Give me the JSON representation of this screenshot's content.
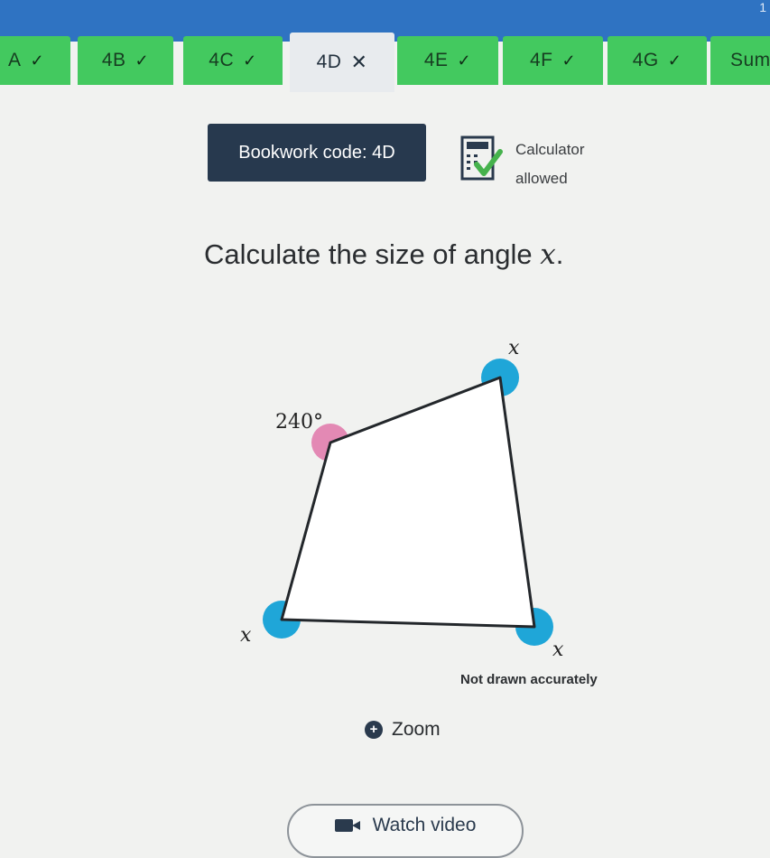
{
  "topbar": {
    "corner_number": "1"
  },
  "tabs": [
    {
      "label": "A",
      "check": "✓"
    },
    {
      "label": "4B",
      "check": "✓"
    },
    {
      "label": "4C",
      "check": "✓"
    },
    {
      "label": "4D",
      "check": "✕"
    },
    {
      "label": "4E",
      "check": "✓"
    },
    {
      "label": "4F",
      "check": "✓"
    },
    {
      "label": "4G",
      "check": "✓"
    },
    {
      "label": "Sum",
      "check": ""
    }
  ],
  "bookwork": {
    "label": "Bookwork code: 4D"
  },
  "calculator": {
    "line1": "Calculator",
    "line2": "allowed"
  },
  "question": {
    "prefix": "Calculate the size of angle ",
    "variable": "x",
    "suffix": "."
  },
  "diagram": {
    "label_top_right": "x",
    "label_top_left": "240°",
    "label_bottom_left": "x",
    "label_bottom_right": "x",
    "colors": {
      "known_angle": "#e389b4",
      "unknown_angle": "#1fa6d8",
      "outline": "#23272b"
    }
  },
  "note": "Not drawn accurately",
  "zoom": {
    "label": "Zoom",
    "icon": "zoom-plus-icon"
  },
  "video": {
    "label": "Watch video",
    "icon": "video-camera-icon"
  }
}
